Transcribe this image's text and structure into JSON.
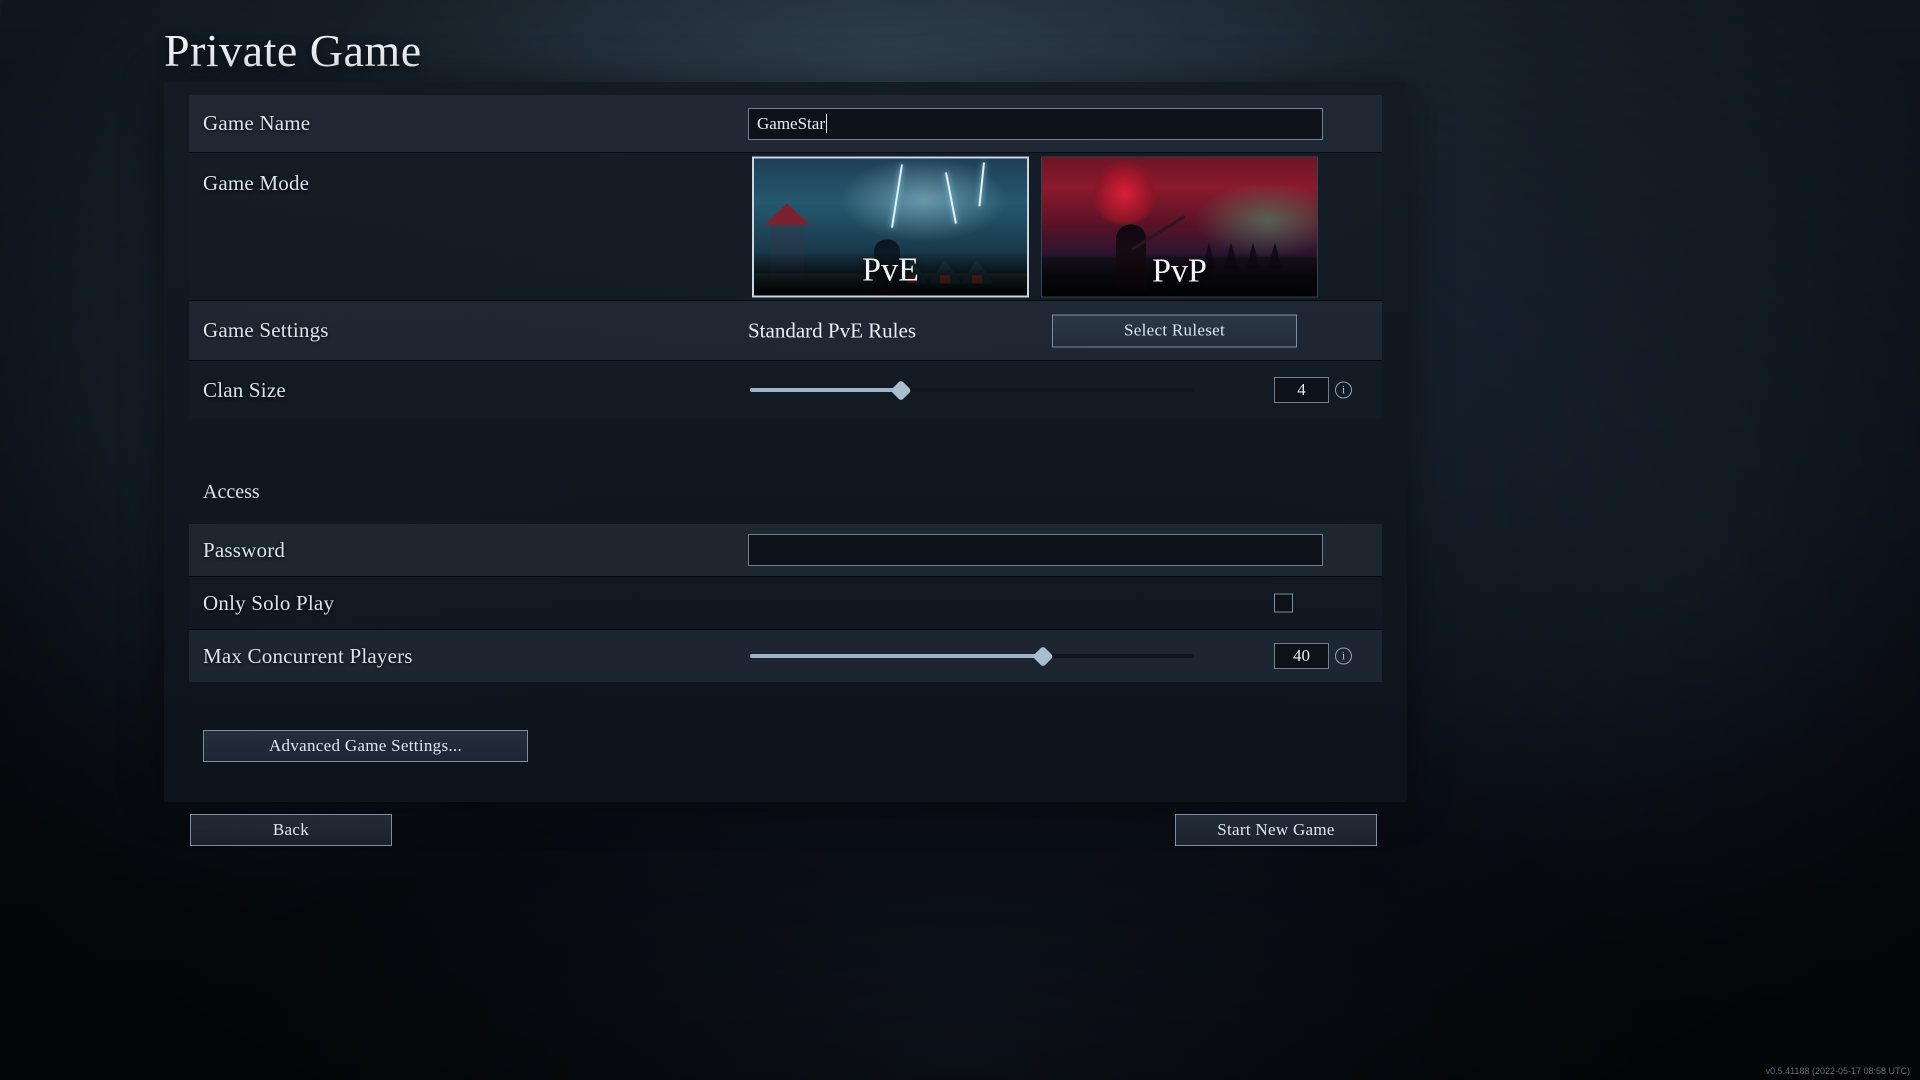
{
  "page": {
    "title": "Private Game",
    "version": "v0.5.41188 (2022-05-17 08:58 UTC)"
  },
  "rows": {
    "game_name": {
      "label": "Game Name",
      "value": "GameStar",
      "placeholder": ""
    },
    "game_mode": {
      "label": "Game Mode",
      "options": [
        {
          "caption": "PvE",
          "selected": true
        },
        {
          "caption": "PvP",
          "selected": false
        }
      ]
    },
    "game_settings": {
      "label": "Game Settings",
      "value": "Standard PvE Rules",
      "button": "Select Ruleset"
    },
    "clan_size": {
      "label": "Clan Size",
      "value": "4",
      "percent": 34,
      "info_icon": "info-icon"
    }
  },
  "access": {
    "heading": "Access",
    "password": {
      "label": "Password",
      "value": "",
      "placeholder": ""
    },
    "only_solo_play": {
      "label": "Only Solo Play",
      "checked": false
    },
    "max_concurrent_players": {
      "label": "Max Concurrent Players",
      "value": "40",
      "percent": 66,
      "info_icon": "info-icon"
    }
  },
  "buttons": {
    "advanced": "Advanced Game Settings...",
    "back": "Back",
    "start": "Start New Game"
  },
  "colors": {
    "panel": "#131a23",
    "row_alt": "#26303c",
    "accent_border": "#7c8fa2",
    "slider_fill": "#9fb5c8",
    "text": "#d9e3ec"
  }
}
